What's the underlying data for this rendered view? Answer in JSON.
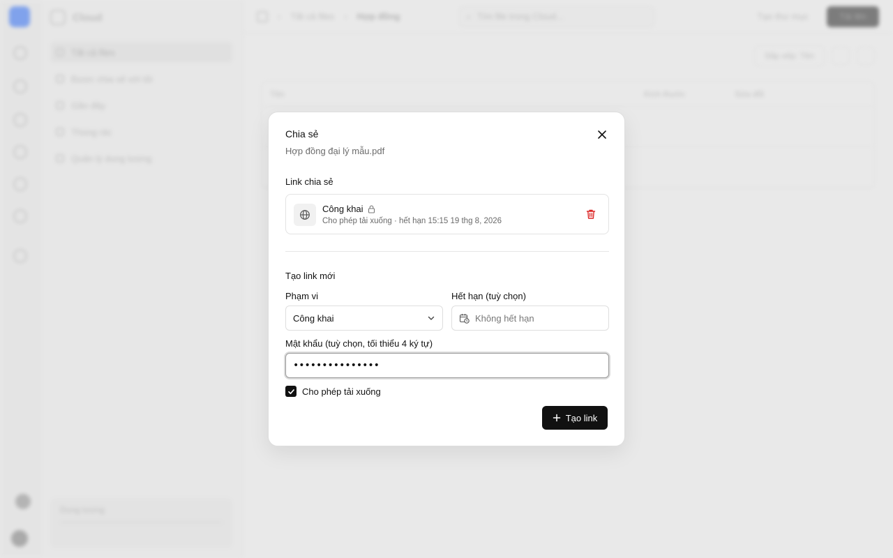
{
  "background": {
    "brand": "Cloud",
    "sidebar_items": [
      "Tất cả files",
      "Được chia sẻ với tôi",
      "Gần đây",
      "Thùng rác",
      "Quản lý dung lượng"
    ],
    "storage_label": "Dung lượng",
    "breadcrumb": [
      "Tất cả files",
      "Hợp đồng"
    ],
    "search_placeholder": "Tìm file trong Cloud...",
    "new_folder_label": "Tạo thư mục",
    "upload_label": "Tải lên",
    "sort_label": "Sắp xếp: Tên",
    "columns": [
      "Tên",
      "Kích thước",
      "Sửa đổi"
    ]
  },
  "dialog": {
    "title": "Chia sẻ",
    "filename": "Hợp đồng đại lý mẫu.pdf",
    "existing_section_label": "Link chia sẻ",
    "existing_link": {
      "scope": "Công khai",
      "meta": "Cho phép tải xuống · hết hạn 15:15 19 thg 8, 2026"
    },
    "new_section_label": "Tạo link mới",
    "scope_label": "Phạm vi",
    "scope_value": "Công khai",
    "expiry_label": "Hết hạn (tuỳ chọn)",
    "expiry_placeholder": "Không hết hạn",
    "password_label": "Mật khẩu (tuỳ chọn, tối thiểu 4 ký tự)",
    "password_value": "•••••••••••••••",
    "allow_download_label": "Cho phép tải xuống",
    "allow_download_checked": true,
    "create_button_label": "Tạo link"
  },
  "colors": {
    "primary_dark": "#111111",
    "danger": "#dc2626",
    "brand_blue": "#4b7ff0"
  }
}
